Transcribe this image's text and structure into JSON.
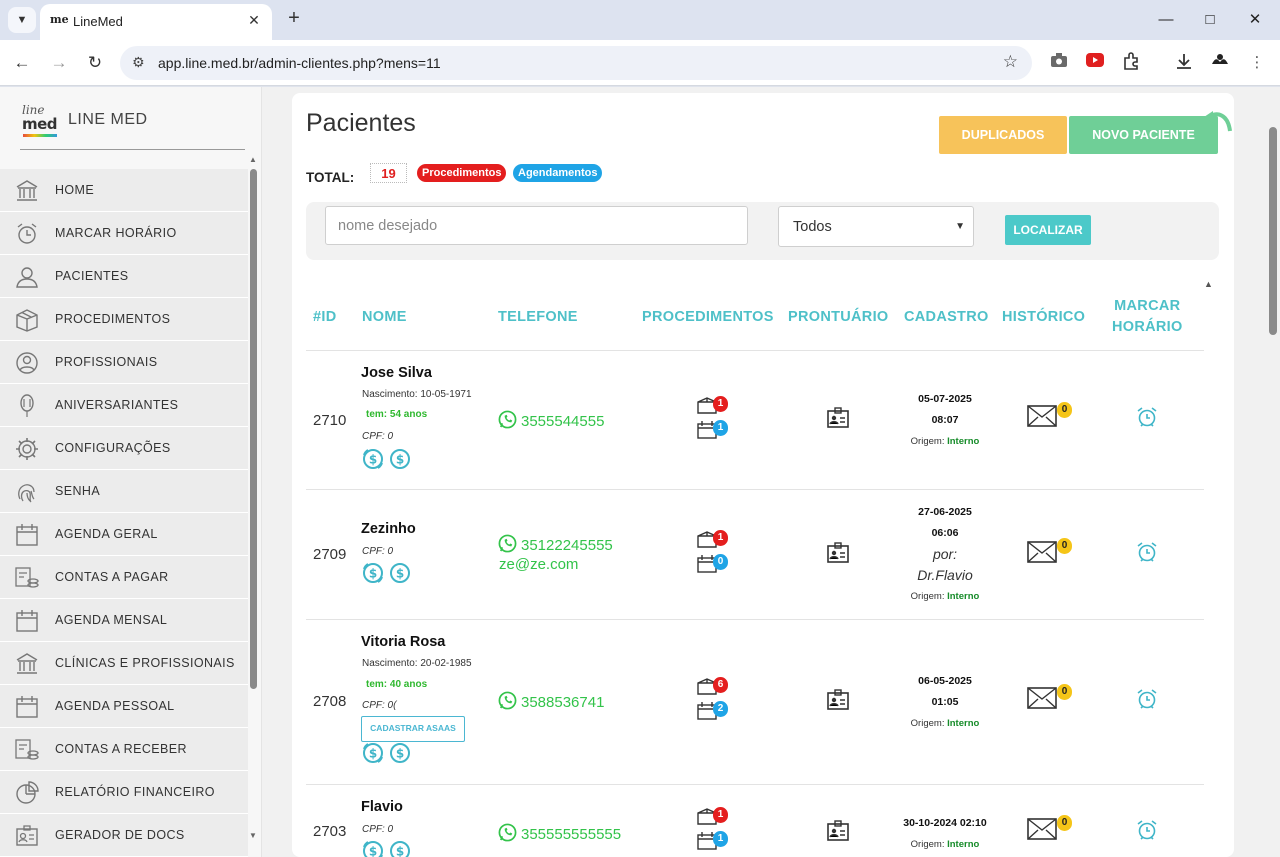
{
  "browser": {
    "tab_title": "LineMed",
    "favicon_text": "me",
    "url": "app.line.med.br/admin-clientes.php?mens=11"
  },
  "brand": {
    "logo_top": "line",
    "logo_bottom": "med",
    "name": "LINE MED"
  },
  "menu": [
    {
      "label": "HOME",
      "icon": "bank-icon"
    },
    {
      "label": "MARCAR HORÁRIO",
      "icon": "alarm-clock-icon"
    },
    {
      "label": "PACIENTES",
      "icon": "user-icon"
    },
    {
      "label": "PROCEDIMENTOS",
      "icon": "box-icon"
    },
    {
      "label": "PROFISSIONAIS",
      "icon": "user-circle-icon"
    },
    {
      "label": "ANIVERSARIANTES",
      "icon": "balloon-icon"
    },
    {
      "label": "CONFIGURAÇÕES",
      "icon": "gear-icon"
    },
    {
      "label": "SENHA",
      "icon": "fingerprint-icon"
    },
    {
      "label": "AGENDA GERAL",
      "icon": "calendar-icon"
    },
    {
      "label": "CONTAS A PAGAR",
      "icon": "money-stack-icon"
    },
    {
      "label": "AGENDA MENSAL",
      "icon": "calendar-icon"
    },
    {
      "label": "CLÍNICAS E PROFISSIONAIS",
      "icon": "bank-icon"
    },
    {
      "label": "AGENDA PESSOAL",
      "icon": "calendar-icon"
    },
    {
      "label": "CONTAS A RECEBER",
      "icon": "money-stack-icon"
    },
    {
      "label": "RELATÓRIO FINANCEIRO",
      "icon": "pie-chart-icon"
    },
    {
      "label": "GERADOR DE DOCS",
      "icon": "id-card-icon"
    }
  ],
  "main": {
    "title": "Pacientes",
    "duplicate_button": "DUPLICADOS",
    "new_button": "NOVO PACIENTE",
    "total_label": "TOTAL:",
    "total_value": "19",
    "pill_procedures": "Procedimentos",
    "pill_appointments": "Agendamentos",
    "search_placeholder": "nome desejado",
    "select_value": "Todos",
    "search_button": "LOCALIZAR"
  },
  "table": {
    "headers": {
      "id": "#ID",
      "name": "NOME",
      "phone": "TELEFONE",
      "procedures": "PROCEDIMENTOS",
      "record": "PRONTUÁRIO",
      "registration": "CADASTRO",
      "history": "HISTÓRICO",
      "schedule_line1": "MARCAR",
      "schedule_line2": "HORÁRIO"
    },
    "rows": [
      {
        "id": "2710",
        "name": "Jose Silva",
        "birth": "Nascimento: 10-05-1971",
        "age": "tem: 54 anos",
        "cpf": "CPF: 0",
        "phone": "3555544555",
        "email": "",
        "proc_count": "1",
        "sched_count": "1",
        "date": "05-07-2025",
        "time": "08:07",
        "by": "",
        "origin_label": "Origem:",
        "origin": "Interno",
        "history_count": "0"
      },
      {
        "id": "2709",
        "name": "Zezinho",
        "birth": "",
        "age": "",
        "cpf": "CPF: 0",
        "phone": "35122245555",
        "email": "ze@ze.com",
        "proc_count": "1",
        "sched_count": "0",
        "date": "27-06-2025",
        "time": "06:06",
        "by_line1": "por:",
        "by_line2": "Dr.Flavio",
        "origin_label": "Origem:",
        "origin": "Interno",
        "history_count": "0"
      },
      {
        "id": "2708",
        "name": "Vitoria Rosa",
        "birth": "Nascimento: 20-02-1985",
        "age": "tem: 40 anos",
        "cpf": "CPF: 0(",
        "asaas": "CADASTRAR ASAAS",
        "phone": "3588536741",
        "email": "",
        "proc_count": "6",
        "sched_count": "2",
        "date": "06-05-2025",
        "time": "01:05",
        "by": "",
        "origin_label": "Origem:",
        "origin": "Interno",
        "history_count": "0"
      },
      {
        "id": "2703",
        "name": "Flavio",
        "birth": "",
        "age": "",
        "cpf": "CPF: 0",
        "phone": "355555555555",
        "email": "",
        "proc_count": "1",
        "sched_count": "1",
        "datetime": "30-10-2024 02:10",
        "by": "",
        "origin_label": "Origem:",
        "origin": "Interno",
        "history_count": "0"
      }
    ]
  },
  "colors": {
    "accent_teal": "#4ec0c8",
    "phone_green": "#33c34a",
    "badge_red": "#e41e1e",
    "badge_blue": "#1fa4e6",
    "badge_yellow": "#f5c518",
    "duplicate_yellow": "#f7c35a",
    "new_green": "#6fcf97"
  }
}
